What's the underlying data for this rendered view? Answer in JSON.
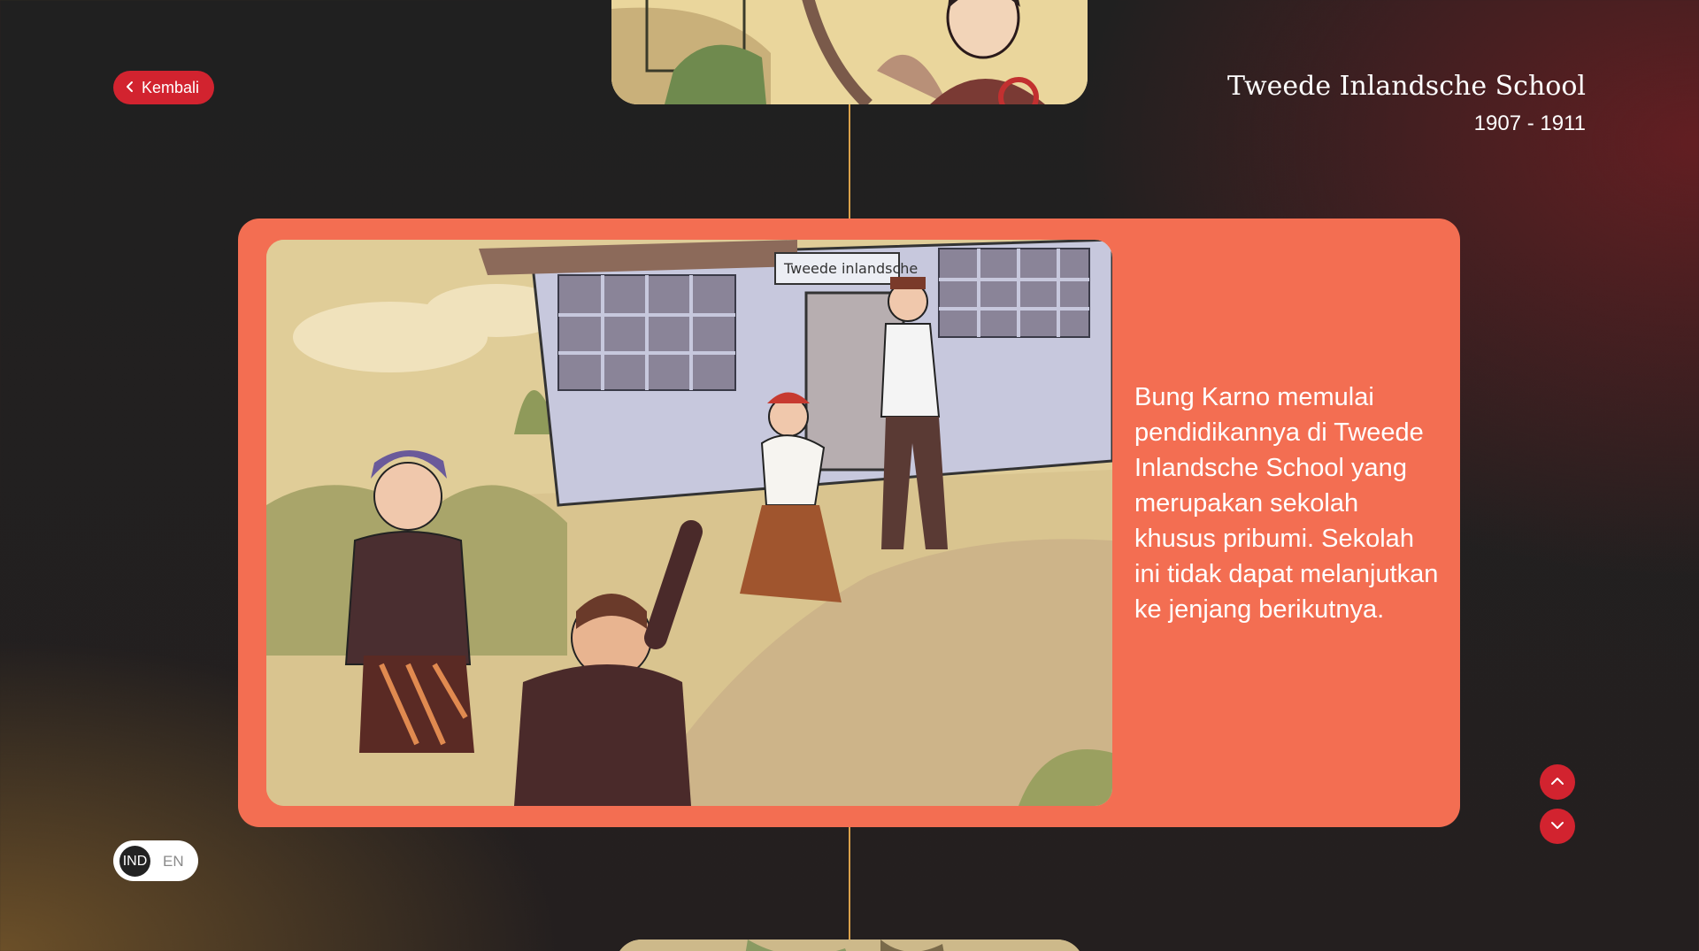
{
  "navigation": {
    "back_label": "Kembali",
    "back_icon": "chevron-left-icon",
    "prev_icon": "chevron-up-icon",
    "next_icon": "chevron-down-icon"
  },
  "header": {
    "title": "Tweede Inlandsche School",
    "years": "1907 - 1911"
  },
  "card": {
    "description": "Bung Karno memulai pendidikannya di Tweede Inlandsche School yang merupakan sekolah khusus pribumi. Sekolah ini tidak dapat melanjutkan ke jenjang berikutnya.",
    "illustration_sign": "Tweede inlandsche"
  },
  "language": {
    "options": [
      "IND",
      "EN"
    ],
    "active": "IND"
  },
  "colors": {
    "accent_red": "#d2232f",
    "card_bg": "#f36e52",
    "timeline": "#d9a04a"
  }
}
